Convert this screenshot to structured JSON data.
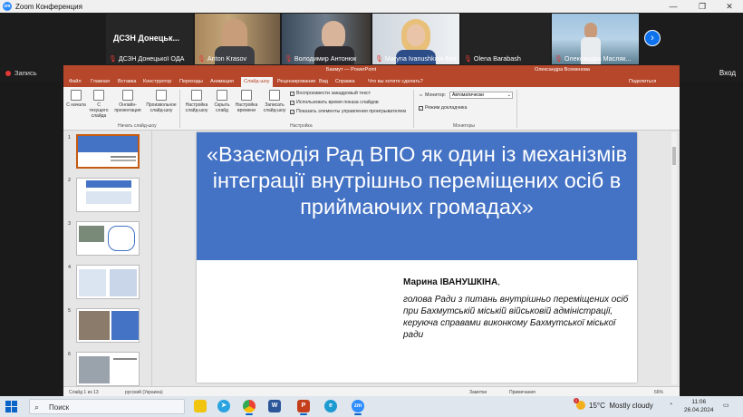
{
  "zoom": {
    "window_title": "Zoom Конференция",
    "window_controls": [
      "—",
      "❐",
      "✕"
    ],
    "first_tile_name": "ДСЗН Донецьк...",
    "participants": [
      {
        "name": "ДСЗН Донецької ОДА"
      },
      {
        "name": "Anton Krasov"
      },
      {
        "name": "Володимир Антонюк"
      },
      {
        "name": "Maryna Ivanushkina Бах..."
      },
      {
        "name": "Olena Barabash"
      },
      {
        "name": "Олександра Масляк..."
      }
    ],
    "next_page_icon": "chevron-right-icon",
    "recording_label": "Запись",
    "exit_label": "Вход"
  },
  "powerpoint": {
    "doc_title": "Бахмут — PowerPoint",
    "user_name": "Олександра Всеменова",
    "tabs": [
      "Файл",
      "Главная",
      "Вставка",
      "Конструктор",
      "Переходы",
      "Анимация",
      "Слайд-шоу",
      "Рецензирование",
      "Вид",
      "Справка",
      "Что вы хотите сделать?"
    ],
    "active_tab": "Слайд-шоу",
    "share_label": "Поделиться",
    "ribbon_buttons": [
      {
        "label": "С начала"
      },
      {
        "label": "С текущего слайда"
      },
      {
        "label": "Онлайн-презентация"
      },
      {
        "label": "Произвольное слайд-шоу"
      },
      {
        "label": "Настройка слайд-шоу"
      },
      {
        "label": "Скрыть слайд"
      },
      {
        "label": "Настройка времени"
      },
      {
        "label": "Записать слайд-шоу"
      }
    ],
    "group_start": "Начать слайд-шоу",
    "group_setup": "Настройка",
    "group_monitors": "Мониторы",
    "checkboxes": [
      {
        "label": "Воспроизвести закадровый текст",
        "checked": true
      },
      {
        "label": "Использовать время показа слайдов",
        "checked": true
      },
      {
        "label": "Показать элементы управления проигрывателем",
        "checked": true
      }
    ],
    "monitor_label": "Монитор:",
    "monitor_value": "Автоматически",
    "presenter_view_label": "Режим докладчика",
    "thumb_numbers": [
      "1",
      "2",
      "3",
      "4",
      "5",
      "6"
    ],
    "slide": {
      "title": "«Взаємодія Рад ВПО як один із механізмів інтеграції внутрішньо переміщених осіб в приймаючих громадах»",
      "author_first": "Марина ",
      "author_last": "ІВАНУШКІНА",
      "author_comma": ",",
      "author_role": "голова Ради з питань внутрішньо переміщених осіб при Бахмутській міській військовій адміністрації, керуюча справами виконкому Бахмутської міської ради"
    },
    "status": {
      "slide_of": "Слайд 1 из 13",
      "language": "русский (Украина)",
      "notes": "Заметки",
      "comments": "Примечания",
      "zoom": "66%"
    }
  },
  "taskbar": {
    "search_placeholder": "Поиск",
    "apps": [
      "file-explorer-icon",
      "telegram-icon",
      "chrome-icon",
      "word-icon",
      "powerpoint-icon",
      "edge-icon",
      "zoom-icon"
    ],
    "weather_temp": "15°C",
    "weather_desc": "Mostly cloudy",
    "weather_badge": "1",
    "time": "11:06",
    "date": "26.04.2024"
  },
  "colors": {
    "ppt_accent": "#b7472a",
    "slide_banner": "#4472c4",
    "zoom_blue": "#0e72ed"
  }
}
